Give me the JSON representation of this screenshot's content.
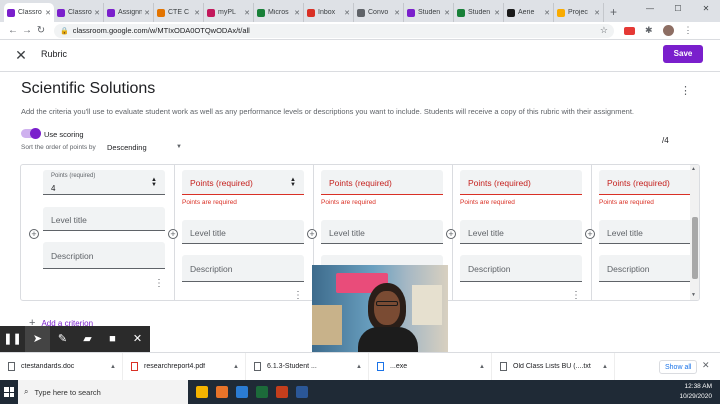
{
  "browser": {
    "tabs": [
      {
        "label": "Classro",
        "color": "#7a1fcc",
        "active": true
      },
      {
        "label": "Classro",
        "color": "#7a1fcc"
      },
      {
        "label": "Assignn",
        "color": "#7a1fcc"
      },
      {
        "label": "CTE C",
        "color": "#e37400"
      },
      {
        "label": "myPL",
        "color": "#c2185b"
      },
      {
        "label": "Micros",
        "color": "#188038"
      },
      {
        "label": "Inbox",
        "color": "#d93025"
      },
      {
        "label": "Convo",
        "color": "#5f6368"
      },
      {
        "label": "Studen",
        "color": "#7a1fcc"
      },
      {
        "label": "Studen",
        "color": "#188038"
      },
      {
        "label": "Aerie",
        "color": "#1a1a1a"
      },
      {
        "label": "Projec",
        "color": "#f9ab00"
      }
    ],
    "url": "classroom.google.com/w/MTIxODA0OTQwODAx/t/all",
    "window_controls": [
      "—",
      "☐",
      "✕"
    ]
  },
  "header": {
    "title": "Rubric",
    "save_label": "Save"
  },
  "rubric": {
    "title": "Scientific Solutions",
    "intro": "Add the criteria you'll use to evaluate student work as well as any performance levels or descriptions you want to include. Students will receive a copy of this rubric with their assignment.",
    "use_scoring_label": "Use scoring",
    "sort_label": "Sort the order of points by",
    "sort_value": "Descending",
    "total": "/4",
    "levels": [
      {
        "points_label": "Points (required)",
        "points_value": "4",
        "title_ph": "Level title",
        "desc_ph": "Description"
      },
      {
        "points_ph": "Points (required)",
        "error": "Points are required",
        "title_ph": "Level title",
        "desc_ph": "Description"
      },
      {
        "points_ph": "Points (required)",
        "error": "Points are required",
        "title_ph": "Level title",
        "desc_ph": "Description"
      },
      {
        "points_ph": "Points (required)",
        "error": "Points are required",
        "title_ph": "Level title",
        "desc_ph": "Description"
      },
      {
        "points_ph": "Points (required)",
        "error": "Points are required",
        "title_ph": "Level title",
        "desc_ph": "Description"
      }
    ],
    "add_criterion": "Add a criterion"
  },
  "downloads": {
    "items": [
      {
        "name": "ctestandards.doc",
        "kind": "doc"
      },
      {
        "name": "researchreport4.pdf",
        "kind": "pdf"
      },
      {
        "name": "6.1.3-Student ...",
        "kind": "doc"
      },
      {
        "name": "...exe",
        "kind": "exe"
      },
      {
        "name": "Old Class Lists BU (....txt",
        "kind": "doc"
      }
    ],
    "show_all": "Show all"
  },
  "taskbar": {
    "search_placeholder": "Type here to search",
    "time": "12:38 AM",
    "date": "10/29/2020",
    "app_colors": [
      "#f5b400",
      "#e8742a",
      "#2b7cd3",
      "#1c6b3a",
      "#c43e1c",
      "#2b5797"
    ]
  }
}
